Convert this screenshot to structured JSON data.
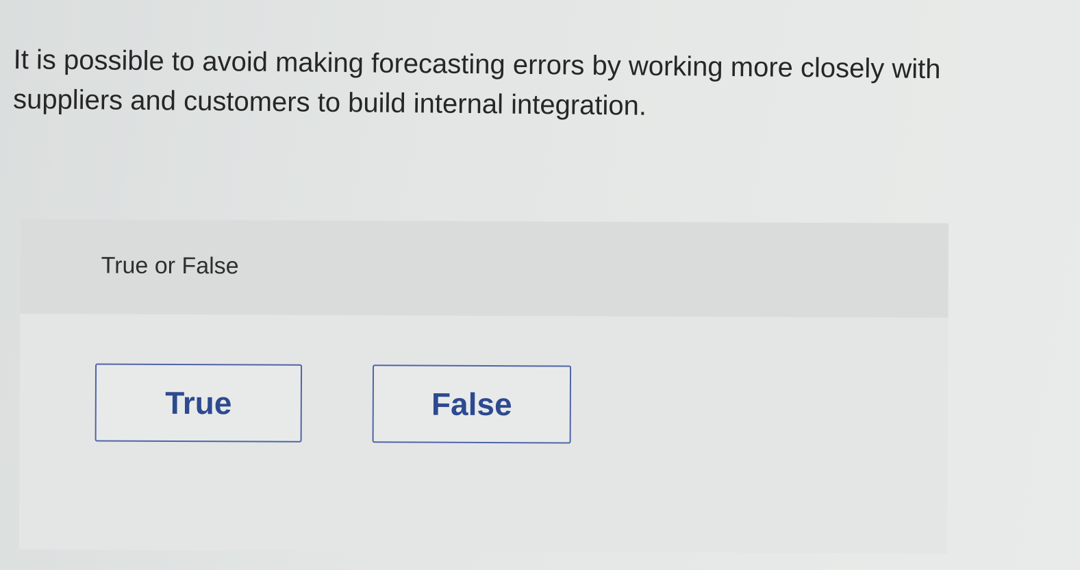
{
  "question": {
    "text": "It is possible to avoid making forecasting errors by working more closely with suppliers and customers to build internal integration."
  },
  "answer_panel": {
    "prompt": "True or False",
    "options": [
      {
        "label": "True"
      },
      {
        "label": "False"
      }
    ]
  },
  "colors": {
    "button_border": "#4f63a8",
    "button_text": "#2d4a8f",
    "panel_header_bg": "#d9dcdb",
    "panel_body_bg": "#e4e6e5"
  }
}
